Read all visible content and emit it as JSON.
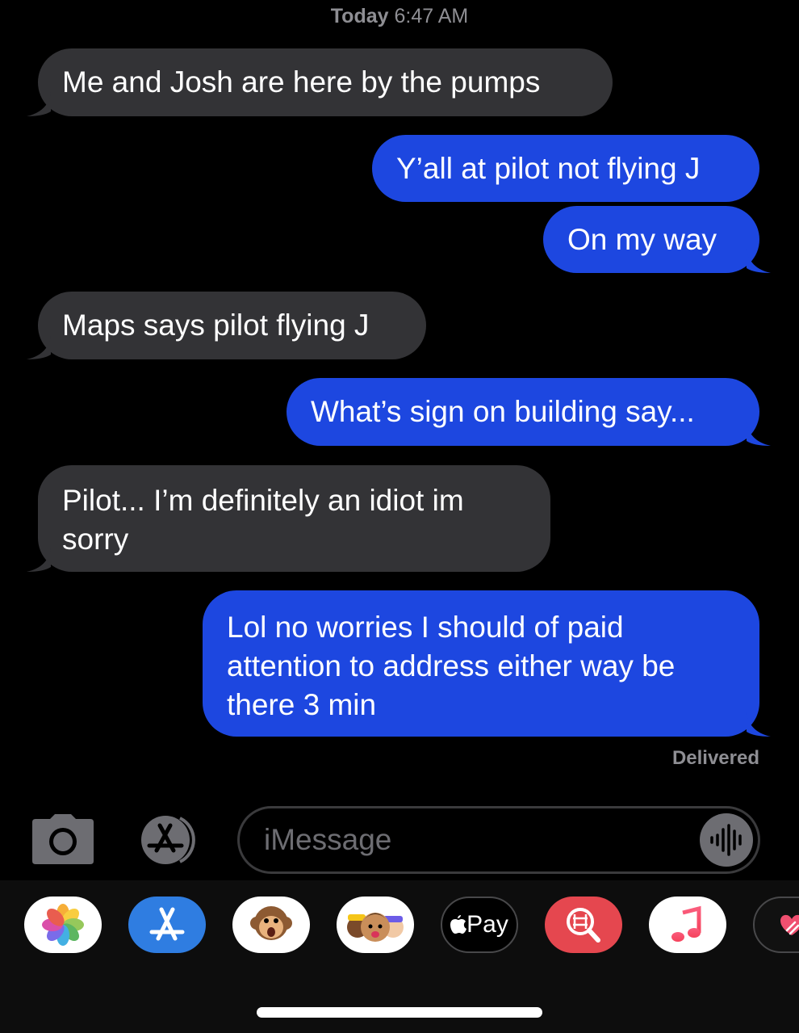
{
  "header": {
    "day": "Today",
    "time": "6:47 AM"
  },
  "messages": [
    {
      "direction": "received",
      "text": "Me and Josh are here by the pumps"
    },
    {
      "direction": "sent",
      "text": "Y’all at pilot not flying J"
    },
    {
      "direction": "sent",
      "text": "On my way"
    },
    {
      "direction": "received",
      "text": "Maps says pilot flying J"
    },
    {
      "direction": "sent",
      "text": "What’s sign on building say..."
    },
    {
      "direction": "received",
      "text": "Pilot...  I’m definitely an idiot im sorry"
    },
    {
      "direction": "sent",
      "text": "Lol no worries I should of paid attention to address either way be there 3 min"
    }
  ],
  "status": {
    "delivered": "Delivered"
  },
  "input": {
    "placeholder": "iMessage"
  },
  "app_drawer": {
    "apps": [
      {
        "icon": "photos-icon"
      },
      {
        "icon": "app-store-icon"
      },
      {
        "icon": "animoji-monkey-icon"
      },
      {
        "icon": "memoji-icon"
      },
      {
        "icon": "apple-pay-icon",
        "label": "Pay"
      },
      {
        "icon": "web-images-icon"
      },
      {
        "icon": "music-icon"
      },
      {
        "icon": "digital-touch-icon"
      }
    ]
  },
  "colors": {
    "sent_bubble": "#1d47e0",
    "received_bubble": "#333336",
    "background": "#000000",
    "secondary_text": "#8e8e93"
  }
}
